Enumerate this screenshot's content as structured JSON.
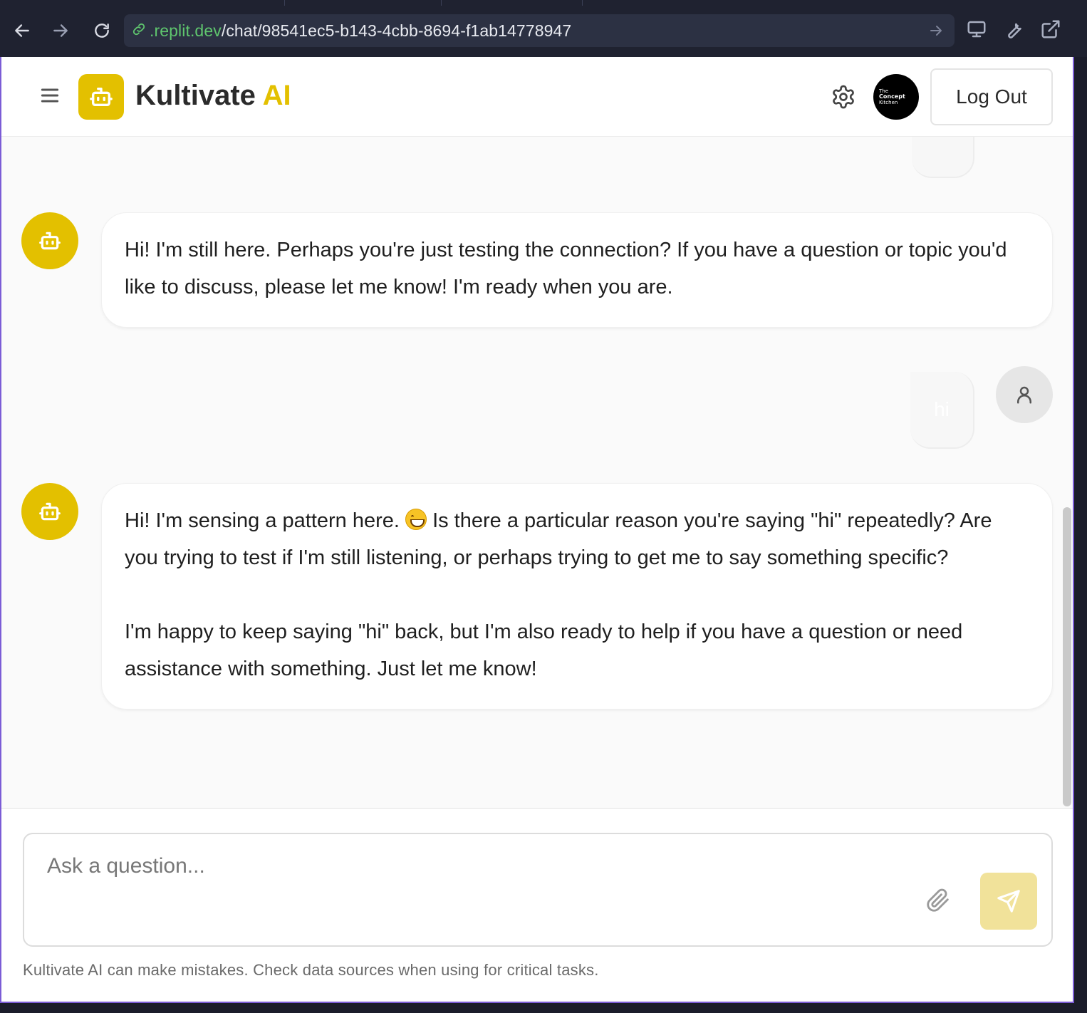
{
  "browser": {
    "url_host": ".replit.dev",
    "url_path": "/chat/98541ec5-b143-4cbb-8694-f1ab14778947",
    "icons": [
      "back-icon",
      "forward-icon",
      "reload-icon",
      "link-icon",
      "go-arrow-icon",
      "monitor-icon",
      "wrench-icon",
      "external-link-icon"
    ]
  },
  "header": {
    "brand_name": "Kultivate",
    "brand_accent": "AI",
    "org_logo_line1": "The",
    "org_logo_line2": "Concept",
    "org_logo_line3": "Kitchen",
    "logout_label": "Log Out"
  },
  "colors": {
    "brand_yellow": "#e3c000",
    "send_button_disabled": "#f1e29a",
    "url_host_green": "#5fc66e"
  },
  "messages": [
    {
      "role": "assistant",
      "paragraphs": [
        "Hi! I'm still here. Perhaps you're just testing the connection? If you have a question or topic you'd like to discuss, please let me know! I'm ready when you are."
      ]
    },
    {
      "role": "user",
      "text": "hi"
    },
    {
      "role": "assistant",
      "p1_before_emoji": "Hi! I'm sensing a pattern here. ",
      "p1_after_emoji": " Is there a particular reason you're saying \"hi\" repeatedly? Are you trying to test if I'm still listening, or perhaps trying to get me to say something specific?",
      "p2": "I'm happy to keep saying \"hi\" back, but I'm also ready to help if you have a question or need assistance with something. Just let me know!"
    }
  ],
  "composer": {
    "placeholder": "Ask a question...",
    "disclaimer": "Kultivate AI can make mistakes. Check data sources when using for critical tasks."
  }
}
